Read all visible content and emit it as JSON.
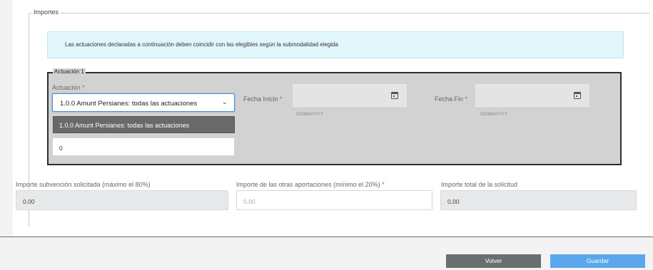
{
  "section": {
    "legend": "Importes"
  },
  "info_message": "Las actuaciones declaradas a continuación deben coincidir con las elegibles según la submodalidad elegida",
  "actuacion": {
    "legend": "Actuación 1",
    "field_label": "Actuación",
    "required_mark": "*",
    "selected_value": "1.0.0 Amunt Persianes: todas las actuaciones",
    "dropdown_option": "1.0.0 Amunt Persianes: todas las actuaciones",
    "amount_value": "0",
    "fecha_inicio": {
      "label": "Fecha Inicio",
      "hint": "DD/MM/YYYY"
    },
    "fecha_fin": {
      "label": "Fecha Fin",
      "hint": "DD/MM/YYYY"
    }
  },
  "importes": {
    "subvencion": {
      "label": "Importe subvención solicitada (máximo el 80%)",
      "value": "0,00"
    },
    "otras": {
      "label": "Importe de las otras aportaciones (mínimo el 20%)",
      "placeholder": "0,00"
    },
    "total": {
      "label": "Importe total de la solicitud",
      "value": "0,00"
    }
  },
  "buttons": {
    "volver": "Volver",
    "guardar": "Guardar"
  },
  "colors": {
    "volver_bg": "#6b6e71",
    "guardar_bg": "#5aa7ee",
    "required": "#e0474c"
  }
}
